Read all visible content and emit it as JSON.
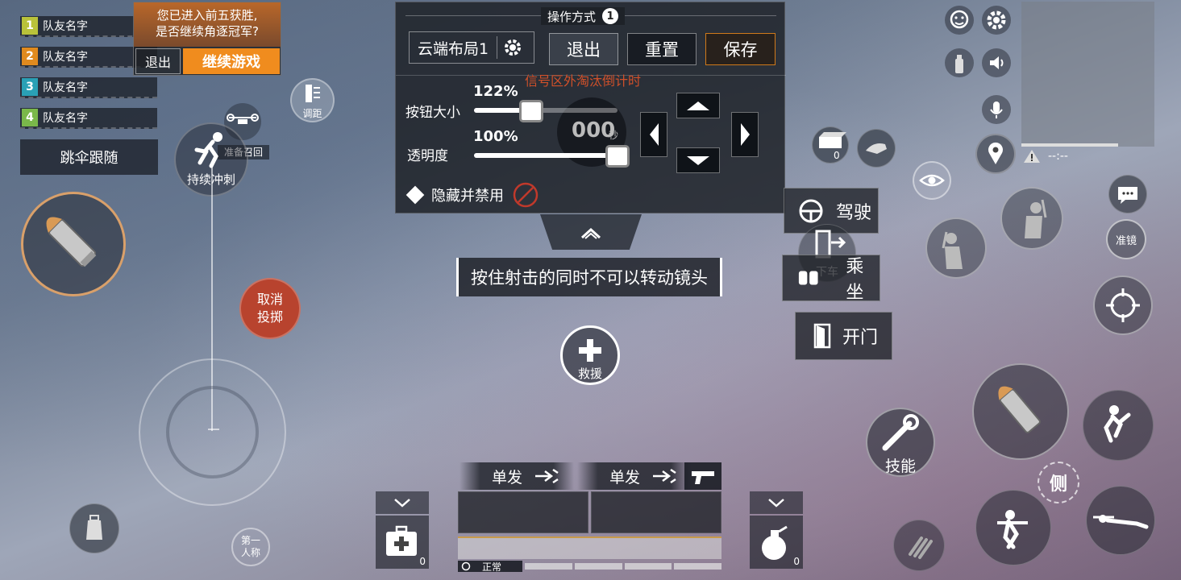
{
  "teammates": [
    {
      "num": "1",
      "name": "队友名字",
      "color": "#b9c23a"
    },
    {
      "num": "2",
      "name": "队友名字",
      "color": "#e08a1e"
    },
    {
      "num": "3",
      "name": "队友名字",
      "color": "#2aa0b5"
    },
    {
      "num": "4",
      "name": "队友名字",
      "color": "#7ab84a"
    }
  ],
  "parachute_follow": "跳伞跟随",
  "top5_popup": {
    "message_line1": "您已进入前五获胜,",
    "message_line2": "是否继续角逐冠军?",
    "exit": "退出",
    "continue": "继续游戏"
  },
  "drone_recall": "准备召回",
  "sprint_label": "持续冲刺",
  "distance_label": "调距",
  "cancel_throw_line1": "取消",
  "cancel_throw_line2": "投掷",
  "first_person_line1": "第一",
  "first_person_line2": "人称",
  "settings_panel": {
    "title": "操作方式",
    "mode_num": "1",
    "layout_name": "云端布局1",
    "exit": "退出",
    "reset": "重置",
    "save": "保存",
    "countdown_label": "信号区外淘汰倒计时",
    "countdown_value": "000",
    "countdown_unit": "秒",
    "button_size_label": "按钮大小",
    "button_size_value": "122%",
    "button_size_fraction": 0.4,
    "opacity_label": "透明度",
    "opacity_value": "100%",
    "opacity_fraction": 1.0,
    "hide_disable": "隐藏并禁用"
  },
  "hint_text": "按住射击的同时不可以转动镜头",
  "rescue": "救援",
  "vehicle": {
    "drive": "驾驶",
    "exit_vehicle": "下车",
    "ride": "乘坐",
    "open_door": "开门"
  },
  "supply_count": "0",
  "minimap_distance": "--:--",
  "scope_label": "准镜",
  "side_label": "侧",
  "skill_label": "技能",
  "weapons": [
    {
      "fire_mode": "单发"
    },
    {
      "fire_mode": "单发"
    }
  ],
  "medkit_count": "0",
  "grenade_count": "0",
  "voice_status": "正常",
  "colors": {
    "save_border": "#d07a1a",
    "continue_bg": "#f08c1e",
    "countdown_text": "#d0502a",
    "cancel_throw_bg": "#b8432e"
  }
}
